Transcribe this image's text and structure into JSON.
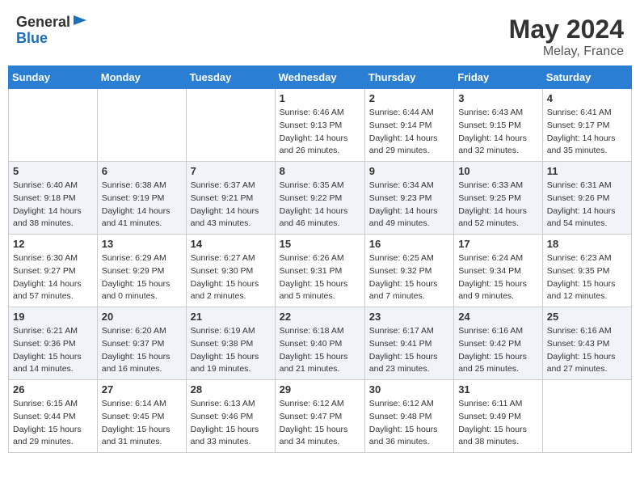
{
  "header": {
    "logo_general": "General",
    "logo_blue": "Blue",
    "title": "May 2024",
    "location": "Melay, France"
  },
  "weekdays": [
    "Sunday",
    "Monday",
    "Tuesday",
    "Wednesday",
    "Thursday",
    "Friday",
    "Saturday"
  ],
  "weeks": [
    [
      {
        "day": "",
        "sunrise": "",
        "sunset": "",
        "daylight": ""
      },
      {
        "day": "",
        "sunrise": "",
        "sunset": "",
        "daylight": ""
      },
      {
        "day": "",
        "sunrise": "",
        "sunset": "",
        "daylight": ""
      },
      {
        "day": "1",
        "sunrise": "Sunrise: 6:46 AM",
        "sunset": "Sunset: 9:13 PM",
        "daylight": "Daylight: 14 hours and 26 minutes."
      },
      {
        "day": "2",
        "sunrise": "Sunrise: 6:44 AM",
        "sunset": "Sunset: 9:14 PM",
        "daylight": "Daylight: 14 hours and 29 minutes."
      },
      {
        "day": "3",
        "sunrise": "Sunrise: 6:43 AM",
        "sunset": "Sunset: 9:15 PM",
        "daylight": "Daylight: 14 hours and 32 minutes."
      },
      {
        "day": "4",
        "sunrise": "Sunrise: 6:41 AM",
        "sunset": "Sunset: 9:17 PM",
        "daylight": "Daylight: 14 hours and 35 minutes."
      }
    ],
    [
      {
        "day": "5",
        "sunrise": "Sunrise: 6:40 AM",
        "sunset": "Sunset: 9:18 PM",
        "daylight": "Daylight: 14 hours and 38 minutes."
      },
      {
        "day": "6",
        "sunrise": "Sunrise: 6:38 AM",
        "sunset": "Sunset: 9:19 PM",
        "daylight": "Daylight: 14 hours and 41 minutes."
      },
      {
        "day": "7",
        "sunrise": "Sunrise: 6:37 AM",
        "sunset": "Sunset: 9:21 PM",
        "daylight": "Daylight: 14 hours and 43 minutes."
      },
      {
        "day": "8",
        "sunrise": "Sunrise: 6:35 AM",
        "sunset": "Sunset: 9:22 PM",
        "daylight": "Daylight: 14 hours and 46 minutes."
      },
      {
        "day": "9",
        "sunrise": "Sunrise: 6:34 AM",
        "sunset": "Sunset: 9:23 PM",
        "daylight": "Daylight: 14 hours and 49 minutes."
      },
      {
        "day": "10",
        "sunrise": "Sunrise: 6:33 AM",
        "sunset": "Sunset: 9:25 PM",
        "daylight": "Daylight: 14 hours and 52 minutes."
      },
      {
        "day": "11",
        "sunrise": "Sunrise: 6:31 AM",
        "sunset": "Sunset: 9:26 PM",
        "daylight": "Daylight: 14 hours and 54 minutes."
      }
    ],
    [
      {
        "day": "12",
        "sunrise": "Sunrise: 6:30 AM",
        "sunset": "Sunset: 9:27 PM",
        "daylight": "Daylight: 14 hours and 57 minutes."
      },
      {
        "day": "13",
        "sunrise": "Sunrise: 6:29 AM",
        "sunset": "Sunset: 9:29 PM",
        "daylight": "Daylight: 15 hours and 0 minutes."
      },
      {
        "day": "14",
        "sunrise": "Sunrise: 6:27 AM",
        "sunset": "Sunset: 9:30 PM",
        "daylight": "Daylight: 15 hours and 2 minutes."
      },
      {
        "day": "15",
        "sunrise": "Sunrise: 6:26 AM",
        "sunset": "Sunset: 9:31 PM",
        "daylight": "Daylight: 15 hours and 5 minutes."
      },
      {
        "day": "16",
        "sunrise": "Sunrise: 6:25 AM",
        "sunset": "Sunset: 9:32 PM",
        "daylight": "Daylight: 15 hours and 7 minutes."
      },
      {
        "day": "17",
        "sunrise": "Sunrise: 6:24 AM",
        "sunset": "Sunset: 9:34 PM",
        "daylight": "Daylight: 15 hours and 9 minutes."
      },
      {
        "day": "18",
        "sunrise": "Sunrise: 6:23 AM",
        "sunset": "Sunset: 9:35 PM",
        "daylight": "Daylight: 15 hours and 12 minutes."
      }
    ],
    [
      {
        "day": "19",
        "sunrise": "Sunrise: 6:21 AM",
        "sunset": "Sunset: 9:36 PM",
        "daylight": "Daylight: 15 hours and 14 minutes."
      },
      {
        "day": "20",
        "sunrise": "Sunrise: 6:20 AM",
        "sunset": "Sunset: 9:37 PM",
        "daylight": "Daylight: 15 hours and 16 minutes."
      },
      {
        "day": "21",
        "sunrise": "Sunrise: 6:19 AM",
        "sunset": "Sunset: 9:38 PM",
        "daylight": "Daylight: 15 hours and 19 minutes."
      },
      {
        "day": "22",
        "sunrise": "Sunrise: 6:18 AM",
        "sunset": "Sunset: 9:40 PM",
        "daylight": "Daylight: 15 hours and 21 minutes."
      },
      {
        "day": "23",
        "sunrise": "Sunrise: 6:17 AM",
        "sunset": "Sunset: 9:41 PM",
        "daylight": "Daylight: 15 hours and 23 minutes."
      },
      {
        "day": "24",
        "sunrise": "Sunrise: 6:16 AM",
        "sunset": "Sunset: 9:42 PM",
        "daylight": "Daylight: 15 hours and 25 minutes."
      },
      {
        "day": "25",
        "sunrise": "Sunrise: 6:16 AM",
        "sunset": "Sunset: 9:43 PM",
        "daylight": "Daylight: 15 hours and 27 minutes."
      }
    ],
    [
      {
        "day": "26",
        "sunrise": "Sunrise: 6:15 AM",
        "sunset": "Sunset: 9:44 PM",
        "daylight": "Daylight: 15 hours and 29 minutes."
      },
      {
        "day": "27",
        "sunrise": "Sunrise: 6:14 AM",
        "sunset": "Sunset: 9:45 PM",
        "daylight": "Daylight: 15 hours and 31 minutes."
      },
      {
        "day": "28",
        "sunrise": "Sunrise: 6:13 AM",
        "sunset": "Sunset: 9:46 PM",
        "daylight": "Daylight: 15 hours and 33 minutes."
      },
      {
        "day": "29",
        "sunrise": "Sunrise: 6:12 AM",
        "sunset": "Sunset: 9:47 PM",
        "daylight": "Daylight: 15 hours and 34 minutes."
      },
      {
        "day": "30",
        "sunrise": "Sunrise: 6:12 AM",
        "sunset": "Sunset: 9:48 PM",
        "daylight": "Daylight: 15 hours and 36 minutes."
      },
      {
        "day": "31",
        "sunrise": "Sunrise: 6:11 AM",
        "sunset": "Sunset: 9:49 PM",
        "daylight": "Daylight: 15 hours and 38 minutes."
      },
      {
        "day": "",
        "sunrise": "",
        "sunset": "",
        "daylight": ""
      }
    ]
  ]
}
